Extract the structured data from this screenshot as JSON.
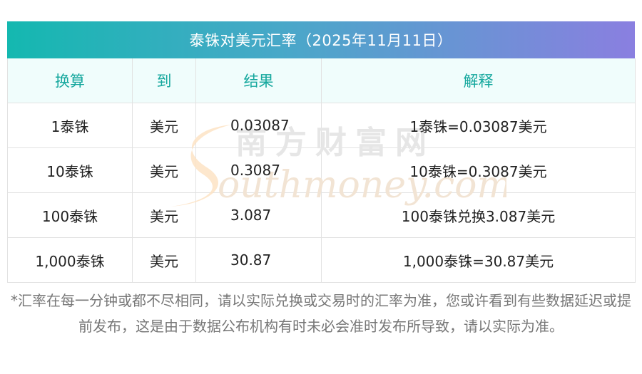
{
  "title": "泰铢对美元汇率（2025年11月11日）",
  "table": {
    "headers": [
      "换算",
      "到",
      "结果",
      "解释"
    ],
    "rows": [
      [
        "1泰铢",
        "美元",
        "0.03087",
        "1泰铢=0.03087美元"
      ],
      [
        "10泰铢",
        "美元",
        "0.3087",
        "10泰铢=0.3087美元"
      ],
      [
        "100泰铢",
        "美元",
        "3.087",
        "100泰铢兑换3.087美元"
      ],
      [
        "1,000泰铢",
        "美元",
        "30.87",
        "1,000泰铢=30.87美元"
      ]
    ]
  },
  "watermark": {
    "cn": "南方财富网",
    "en": "outhmoney.com"
  },
  "footnote": "*汇率在每一分钟或都不尽相同，请以实际兑换或交易时的汇率为准，您或许看到有些数据延迟或提前发布，这是由于数据公布机构有时未必会准时发布所导致，请以实际为准。",
  "colors": {
    "title_gradient_start": "#14b8b0",
    "title_gradient_end": "#8a7fe0",
    "header_text": "#16a89e",
    "header_bg": "#f0fdfc"
  }
}
